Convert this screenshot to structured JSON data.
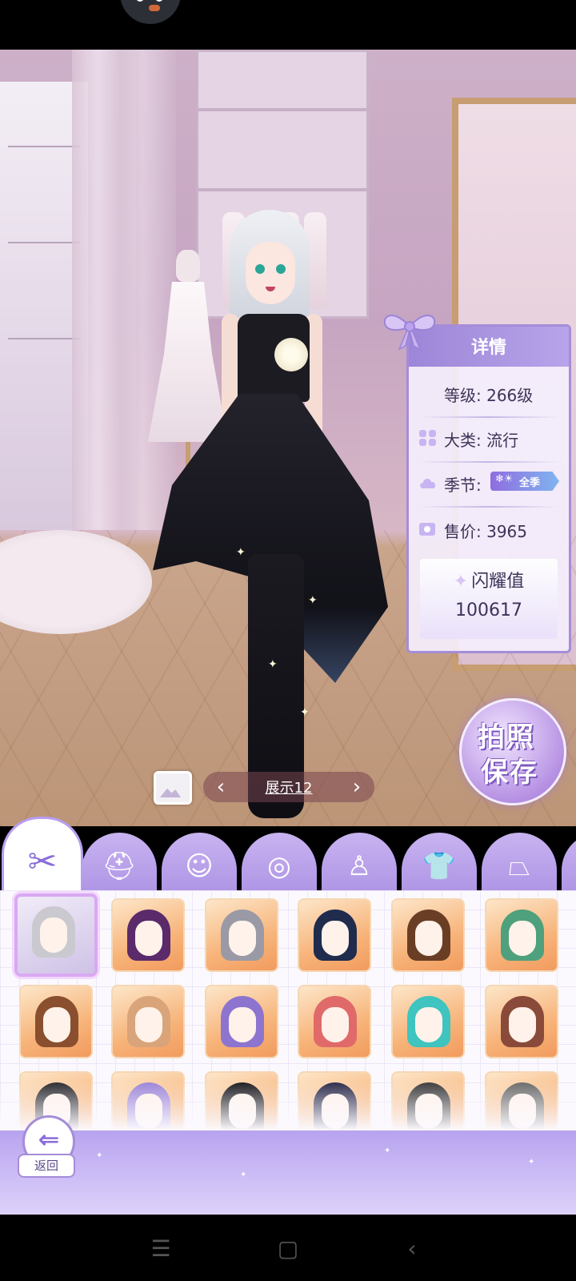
{
  "details": {
    "title": "详情",
    "level": "等级: 266级",
    "category_label": "大类: 流行",
    "season_label": "季节:",
    "season_badge": "全季",
    "price_label": "售价: 3965",
    "shine_label": "闪耀值",
    "shine_value": "100617"
  },
  "photo_save": {
    "line1": "拍照",
    "line2": "保存"
  },
  "pager": {
    "label": "展示12",
    "prev": "‹",
    "next": "›"
  },
  "tabs": [
    {
      "name": "hair",
      "glyph": "✂"
    },
    {
      "name": "hat",
      "glyph": "⛑"
    },
    {
      "name": "face",
      "glyph": "☺"
    },
    {
      "name": "earrings",
      "glyph": "◎"
    },
    {
      "name": "dress",
      "glyph": "♙"
    },
    {
      "name": "top",
      "glyph": "👕"
    },
    {
      "name": "skirt",
      "glyph": "⏢"
    }
  ],
  "hair_items": [
    {
      "color": "#c9c9cf"
    },
    {
      "color": "#5a2a6a"
    },
    {
      "color": "#9a9aa6"
    },
    {
      "color": "#1f2c4e"
    },
    {
      "color": "#6a3e25"
    },
    {
      "color": "#4fa07c"
    },
    {
      "color": "#8a4f2e"
    },
    {
      "color": "#d9a479"
    },
    {
      "color": "#8d74cf"
    },
    {
      "color": "#e06a6a"
    },
    {
      "color": "#3fc4bf"
    },
    {
      "color": "#8a4a3a"
    },
    {
      "color": "#2a2a2e"
    },
    {
      "color": "#9b84d8"
    },
    {
      "color": "#1a1a1e"
    },
    {
      "color": "#2a2a4a"
    },
    {
      "color": "#3a3a3a"
    },
    {
      "color": "#6a6a6a"
    }
  ],
  "back": {
    "label": "返回",
    "glyph": "⇐"
  },
  "nav": {
    "menu": "☰",
    "home": "▢",
    "back": "‹"
  }
}
